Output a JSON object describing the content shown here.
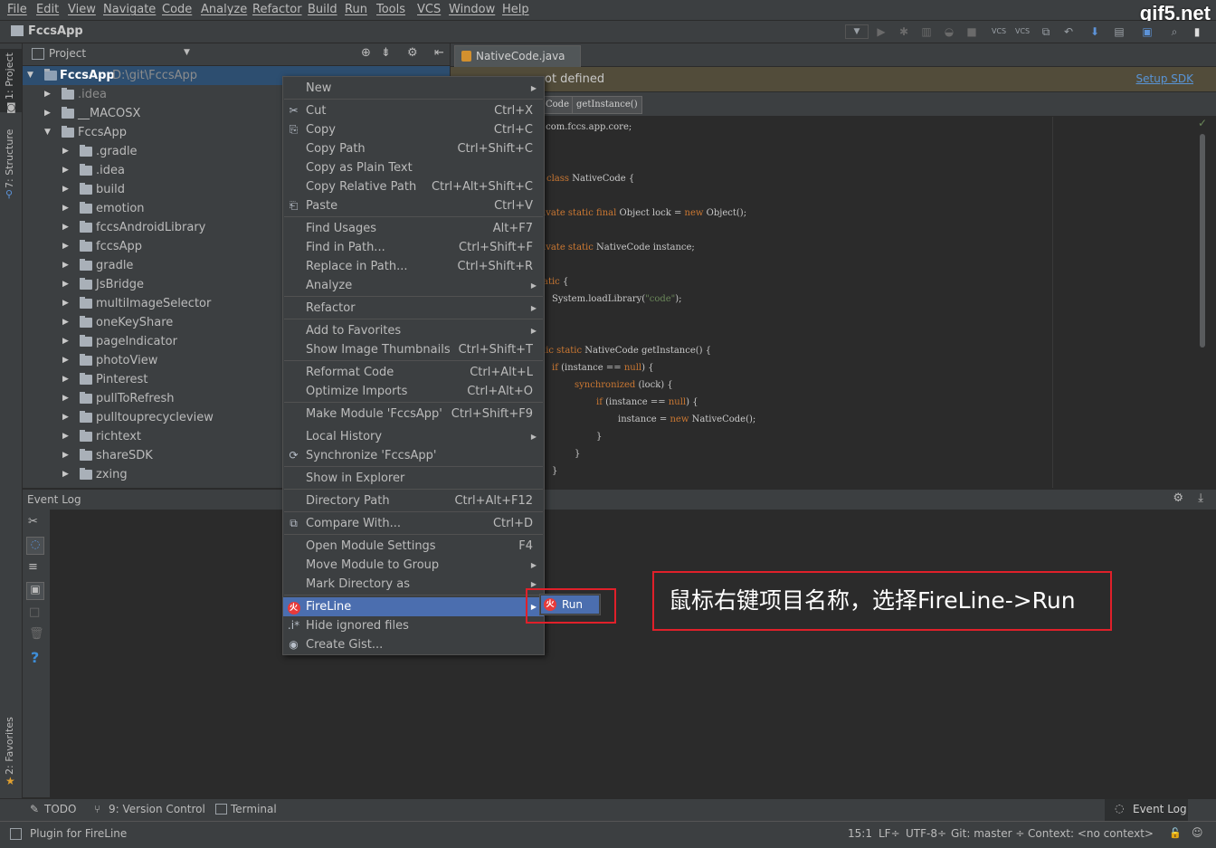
{
  "menubar": {
    "items": [
      "File",
      "Edit",
      "View",
      "Navigate",
      "Code",
      "Analyze",
      "Refactor",
      "Build",
      "Run",
      "Tools",
      "VCS",
      "Window",
      "Help"
    ],
    "watermark": "gif5.net"
  },
  "navbar": {
    "project": "FccsApp"
  },
  "left_stripe": {
    "project_tab": "1: Project",
    "structure_tab": "7: Structure",
    "favorites_tab": "2: Favorites"
  },
  "project_panel": {
    "title": "Project",
    "root": {
      "name": "FccsApp",
      "path": "D:\\git\\FccsApp"
    },
    "level1": [
      ".idea",
      "__MACOSX",
      "FccsApp"
    ],
    "level2": [
      ".gradle",
      ".idea",
      "build",
      "emotion",
      "fccsAndroidLibrary",
      "fccsApp",
      "gradle",
      "JsBridge",
      "multiImageSelector",
      "oneKeyShare",
      "pageIndicator",
      "photoView",
      "Pinterest",
      "pullToRefresh",
      "pulltouprecycleview",
      "richtext",
      "shareSDK",
      "zxing"
    ]
  },
  "editor": {
    "tab": "NativeCode.java",
    "sdk_warning": "Project SDK is not defined",
    "sdk_warning_visible": "ot defined",
    "setup_sdk": "Setup SDK",
    "crumbs": [
      "Code",
      "getInstance()"
    ],
    "code": {
      "l1_pre": "e",
      "l1": "com.fccs.app.core;",
      "l2_kw": "class",
      "l2": "NativeCode {",
      "l3_kw": "ivate static final",
      "l3a": "Object lock =",
      "l3_kw2": "new",
      "l3b": "Object();",
      "l4_kw": "ivate static",
      "l4": "NativeCode instance;",
      "l5_kw": "atic",
      "l5": "{",
      "l6a": "System.loadLibrary(",
      "l6_str": "\"code\"",
      "l6b": ");",
      "l7_kw": "lic static",
      "l7": "NativeCode getInstance() {",
      "l8_kw": "if",
      "l8a": "(instance ==",
      "l8_kw2": "null",
      "l8b": ") {",
      "l9_kw": "synchronized",
      "l9": "(lock) {",
      "l10_kw": "if",
      "l10a": "(instance ==",
      "l10_kw2": "null",
      "l10b": ") {",
      "l11a": "instance =",
      "l11_kw": "new",
      "l11b": "NativeCode();",
      "l12": "}",
      "l13": "}",
      "l14": "}"
    }
  },
  "event_log": {
    "title": "Event Log"
  },
  "context_menu": {
    "items": [
      {
        "label": "New",
        "shortcut": ""
      },
      {
        "label": "Cut",
        "shortcut": "Ctrl+X"
      },
      {
        "label": "Copy",
        "shortcut": "Ctrl+C"
      },
      {
        "label": "Copy Path",
        "shortcut": "Ctrl+Shift+C"
      },
      {
        "label": "Copy as Plain Text",
        "shortcut": ""
      },
      {
        "label": "Copy Relative Path",
        "shortcut": "Ctrl+Alt+Shift+C"
      },
      {
        "label": "Paste",
        "shortcut": "Ctrl+V"
      },
      {
        "label": "Find Usages",
        "shortcut": "Alt+F7"
      },
      {
        "label": "Find in Path...",
        "shortcut": "Ctrl+Shift+F"
      },
      {
        "label": "Replace in Path...",
        "shortcut": "Ctrl+Shift+R"
      },
      {
        "label": "Analyze",
        "shortcut": ""
      },
      {
        "label": "Refactor",
        "shortcut": ""
      },
      {
        "label": "Add to Favorites",
        "shortcut": ""
      },
      {
        "label": "Show Image Thumbnails",
        "shortcut": "Ctrl+Shift+T"
      },
      {
        "label": "Reformat Code",
        "shortcut": "Ctrl+Alt+L"
      },
      {
        "label": "Optimize Imports",
        "shortcut": "Ctrl+Alt+O"
      },
      {
        "label": "Make Module 'FccsApp'",
        "shortcut": "Ctrl+Shift+F9"
      },
      {
        "label": "Local History",
        "shortcut": ""
      },
      {
        "label": "Synchronize 'FccsApp'",
        "shortcut": ""
      },
      {
        "label": "Show in Explorer",
        "shortcut": ""
      },
      {
        "label": "Directory Path",
        "shortcut": "Ctrl+Alt+F12"
      },
      {
        "label": "Compare With...",
        "shortcut": "Ctrl+D"
      },
      {
        "label": "Open Module Settings",
        "shortcut": "F4"
      },
      {
        "label": "Move Module to Group",
        "shortcut": ""
      },
      {
        "label": "Mark Directory as",
        "shortcut": ""
      },
      {
        "label": "FireLine",
        "shortcut": ""
      },
      {
        "label": "Hide ignored files",
        "shortcut": ""
      },
      {
        "label": "Create Gist...",
        "shortcut": ""
      }
    ],
    "submenu_run": "Run"
  },
  "annotation": "鼠标右键项目名称，选择FireLine->Run",
  "bottom_tabs": {
    "todo": "TODO",
    "vcs": "9: Version Control",
    "terminal": "Terminal",
    "event_log": "Event Log"
  },
  "status": {
    "message": "Plugin for FireLine",
    "position": "15:1",
    "line_sep": "LF÷",
    "encoding": "UTF-8÷",
    "git": "Git: master ÷",
    "context": "Context: <no context>"
  },
  "colors": {
    "selection": "#4b6eaf",
    "highlight_box": "#e0202a",
    "keyword": "#cc7832",
    "string": "#6a8759"
  }
}
